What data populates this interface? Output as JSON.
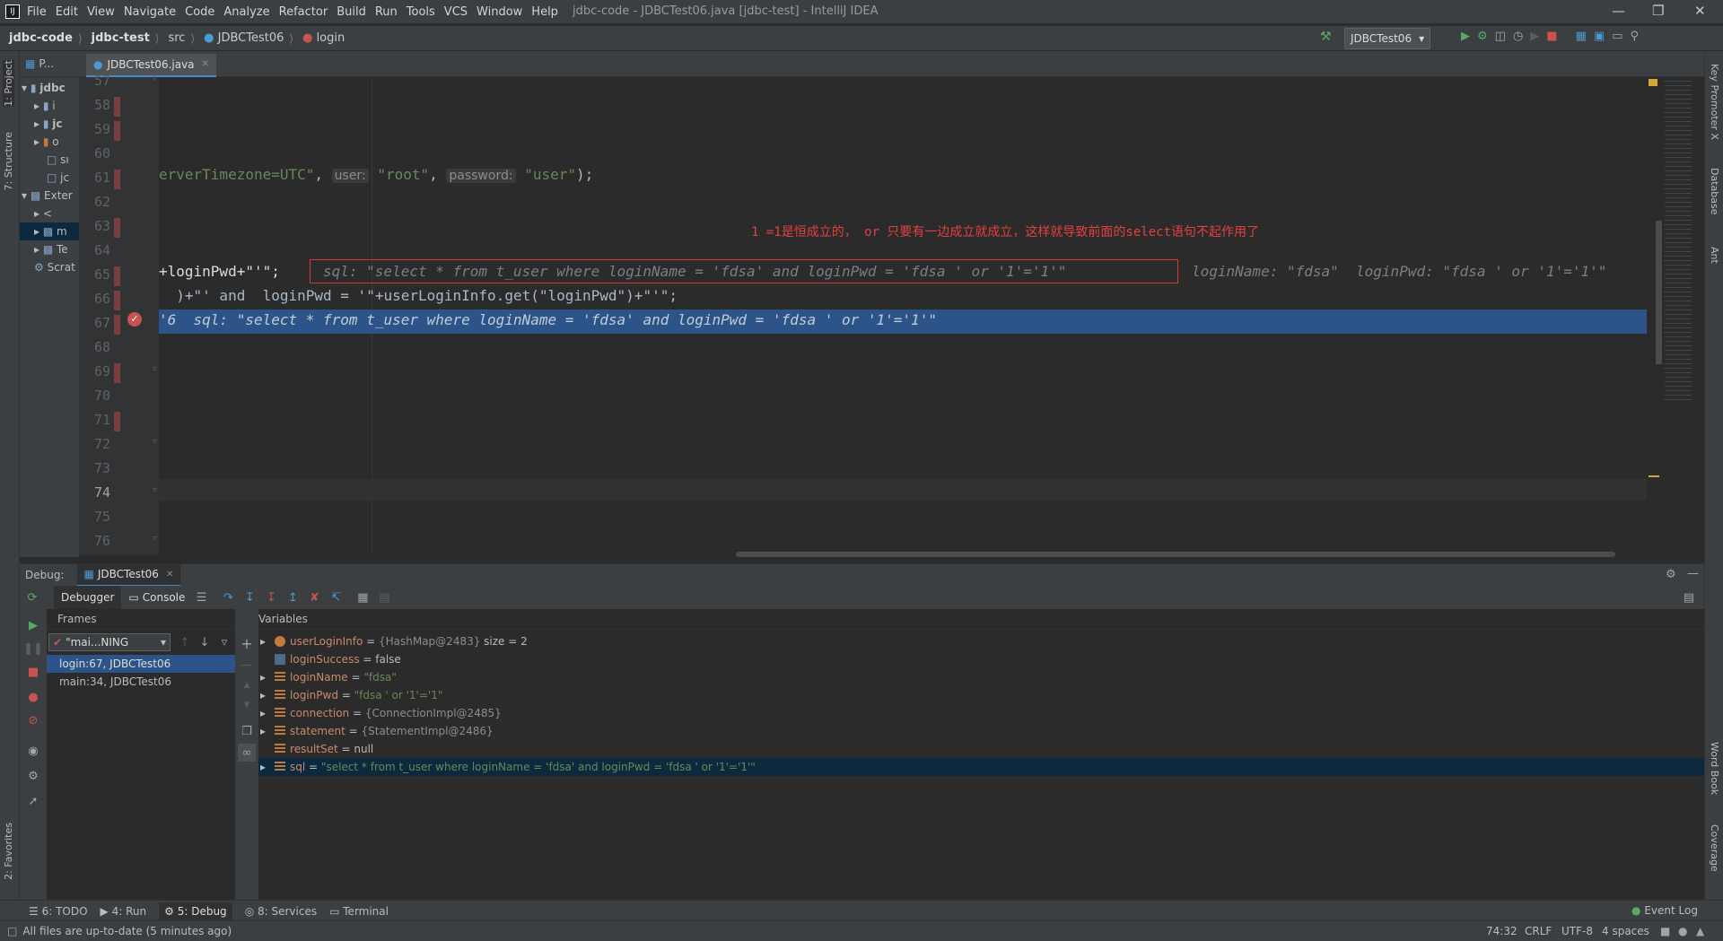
{
  "app": {
    "title": "jdbc-code - JDBCTest06.java [jdbc-test] - IntelliJ IDEA",
    "menu": [
      "File",
      "Edit",
      "View",
      "Navigate",
      "Code",
      "Analyze",
      "Refactor",
      "Build",
      "Run",
      "Tools",
      "VCS",
      "Window",
      "Help"
    ]
  },
  "breadcrumb": {
    "project": "jdbc-code",
    "module": "jdbc-test",
    "src": "src",
    "class": "JDBCTest06",
    "method": "login"
  },
  "run_config": "JDBCTest06",
  "left_stripe": {
    "project": "1: Project",
    "structure": "7: Structure",
    "favorites": "2: Favorites"
  },
  "right_stripe": {
    "key_promoter": "Key Promoter X",
    "database": "Database",
    "ant": "Ant",
    "word_book": "Word Book",
    "coverage": "Coverage"
  },
  "project_panel": {
    "header": "P...",
    "items": [
      "jdbc",
      "i",
      "jc",
      "o",
      "sı",
      "jc",
      "Exter",
      "<",
      "m",
      "Te",
      "Scrat"
    ]
  },
  "editor": {
    "tab": "JDBCTest06.java",
    "line_numbers": [
      "57",
      "58",
      "59",
      "60",
      "61",
      "62",
      "63",
      "64",
      "65",
      "66",
      "67",
      "68",
      "69",
      "70",
      "71",
      "72",
      "73",
      "74",
      "75",
      "76"
    ],
    "line61": {
      "a": "erverTimezone=UTC\"",
      "comma": ", ",
      "hint_user": "user:",
      "v1": "\"root\"",
      "hint_pwd": "password:",
      "v2": "\"user\"",
      "end": ");"
    },
    "annotation": "1 =1是恒成立的， or  只要有一边成立就成立，这样就导致前面的select语句不起作用了",
    "line65": {
      "code": "+loginPwd+\"'\";",
      "inline_sql": "sql: \"select * from t_user where loginName = 'fdsa' and loginPwd = 'fdsa ' or '1'='1'\"",
      "inline_rest": "loginName: \"fdsa\"  loginPwd: \"fdsa ' or '1'='1'\""
    },
    "line66": "  )+\"' and  loginPwd = '\"+userLoginInfo.get(\"loginPwd\")+\"'\";",
    "line67": "'6  sql: \"select * from t_user where loginName = 'fdsa' and loginPwd = 'fdsa ' or '1'='1'\""
  },
  "debug": {
    "label": "Debug:",
    "session": "JDBCTest06",
    "tabs": [
      "Debugger",
      "Console"
    ],
    "frames_title": "Frames",
    "thread": "\"mai...NING",
    "frames": [
      "login:67, JDBCTest06",
      "main:34, JDBCTest06"
    ],
    "variables_title": "Variables",
    "variables": [
      {
        "name": "userLoginInfo",
        "eq": " = ",
        "value": "{HashMap@2483}",
        "extra": "  size = 2",
        "kind": "obj"
      },
      {
        "name": "loginSuccess",
        "eq": " = ",
        "value": "false",
        "extra": "",
        "kind": "prim"
      },
      {
        "name": "loginName",
        "eq": " = ",
        "value": "\"fdsa\"",
        "extra": "",
        "kind": "str"
      },
      {
        "name": "loginPwd",
        "eq": " = ",
        "value": "\"fdsa ' or '1'='1\"",
        "extra": "",
        "kind": "str"
      },
      {
        "name": "connection",
        "eq": " = ",
        "value": "{ConnectionImpl@2485}",
        "extra": "",
        "kind": "obj"
      },
      {
        "name": "statement",
        "eq": " = ",
        "value": "{StatementImpl@2486}",
        "extra": "",
        "kind": "obj"
      },
      {
        "name": "resultSet",
        "eq": " = ",
        "value": "null",
        "extra": "",
        "kind": "prim"
      },
      {
        "name": "sql",
        "eq": " = ",
        "value": "\"select * from t_user where loginName = 'fdsa' and loginPwd = 'fdsa ' or '1'='1'\"",
        "extra": "",
        "kind": "str"
      }
    ]
  },
  "bottom_tabs": {
    "todo": "6: TODO",
    "run": "4: Run",
    "debug": "5: Debug",
    "services": "8: Services",
    "terminal": "Terminal",
    "event_log": "Event Log"
  },
  "status": {
    "message": "All files are up-to-date (5 minutes ago)",
    "position": "74:32",
    "line_sep": "CRLF",
    "encoding": "UTF-8",
    "indent": "4 spaces"
  },
  "colors": {
    "selection": "#2d5488",
    "breakpoint": "#c75450",
    "annotation": "#e34040",
    "string": "#6a8759",
    "var_name": "#c98a6c"
  }
}
